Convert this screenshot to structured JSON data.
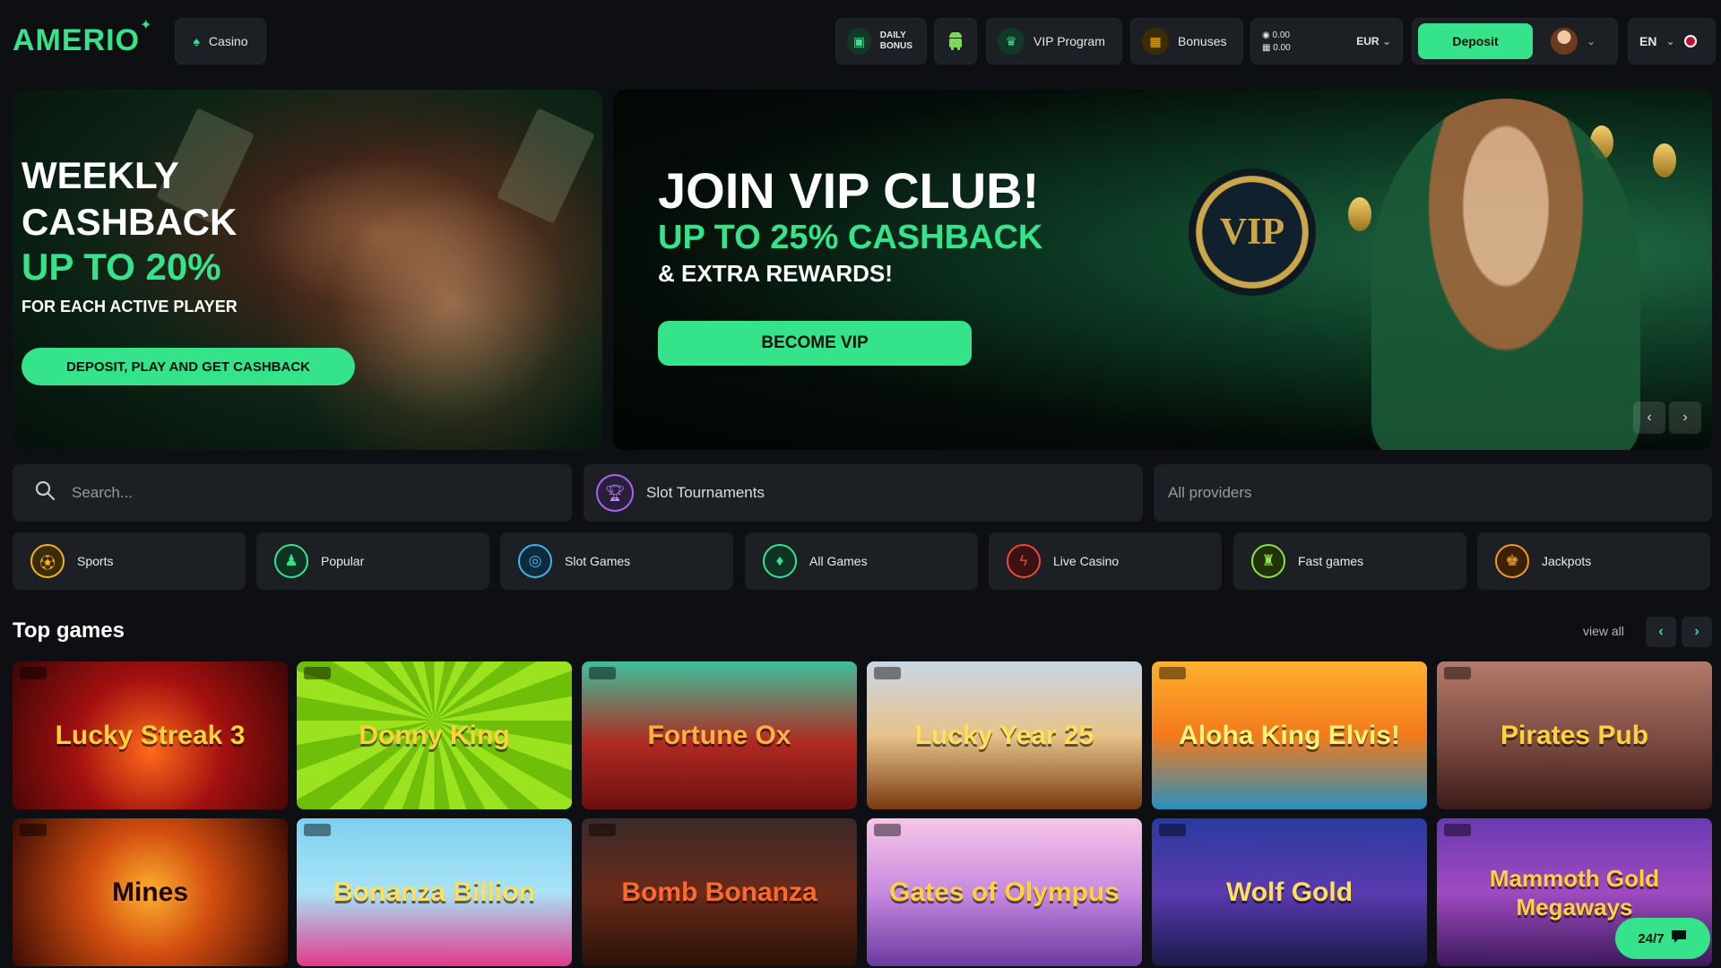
{
  "header": {
    "logo": "AMERIO",
    "casino_label": "Casino",
    "daily_bonus_label": "DAILY BONUS",
    "vip_label": "VIP Program",
    "bonuses_label": "Bonuses",
    "wallet": {
      "cash": "0.00",
      "bonus": "0.00",
      "currency": "EUR"
    },
    "deposit_label": "Deposit",
    "language": "EN"
  },
  "banner_left": {
    "title": "WEEKLY CASHBACK",
    "highlight": "UP TO 20%",
    "subtitle": "FOR EACH ACTIVE PLAYER",
    "button": "DEPOSIT, PLAY AND GET CASHBACK"
  },
  "banner_right": {
    "title": "JOIN VIP CLUB!",
    "highlight": "UP TO 25% CASHBACK",
    "subtitle": "& EXTRA REWARDS!",
    "button": "BECOME VIP",
    "badge": "VIP"
  },
  "filters": {
    "search_placeholder": "Search...",
    "tournaments_label": "Slot Tournaments",
    "providers_label": "All providers"
  },
  "categories": [
    {
      "label": "Sports",
      "icon": "sports-icon"
    },
    {
      "label": "Popular",
      "icon": "popular-icon"
    },
    {
      "label": "Slot Games",
      "icon": "slot-games-icon"
    },
    {
      "label": "All Games",
      "icon": "all-games-icon"
    },
    {
      "label": "Live Casino",
      "icon": "live-casino-icon"
    },
    {
      "label": "Fast games",
      "icon": "fast-games-icon"
    },
    {
      "label": "Jackpots",
      "icon": "jackpots-icon"
    }
  ],
  "top_games": {
    "title": "Top games",
    "view_all": "view all",
    "games": [
      {
        "name": "Lucky Streak 3"
      },
      {
        "name": "Donny King"
      },
      {
        "name": "Fortune Ox"
      },
      {
        "name": "Lucky Year 25"
      },
      {
        "name": "Aloha King Elvis!"
      },
      {
        "name": "Pirates Pub"
      },
      {
        "name": "Mines"
      },
      {
        "name": "Bonanza Billion"
      },
      {
        "name": "Bomb Bonanza"
      },
      {
        "name": "Gates of Olympus"
      },
      {
        "name": "Wolf Gold"
      },
      {
        "name": "Mammoth Gold Megaways"
      }
    ]
  },
  "support": {
    "label": "24/7"
  },
  "colors": {
    "accent": "#35e38a",
    "background": "#0d0f12",
    "panel": "#1c1f24"
  }
}
